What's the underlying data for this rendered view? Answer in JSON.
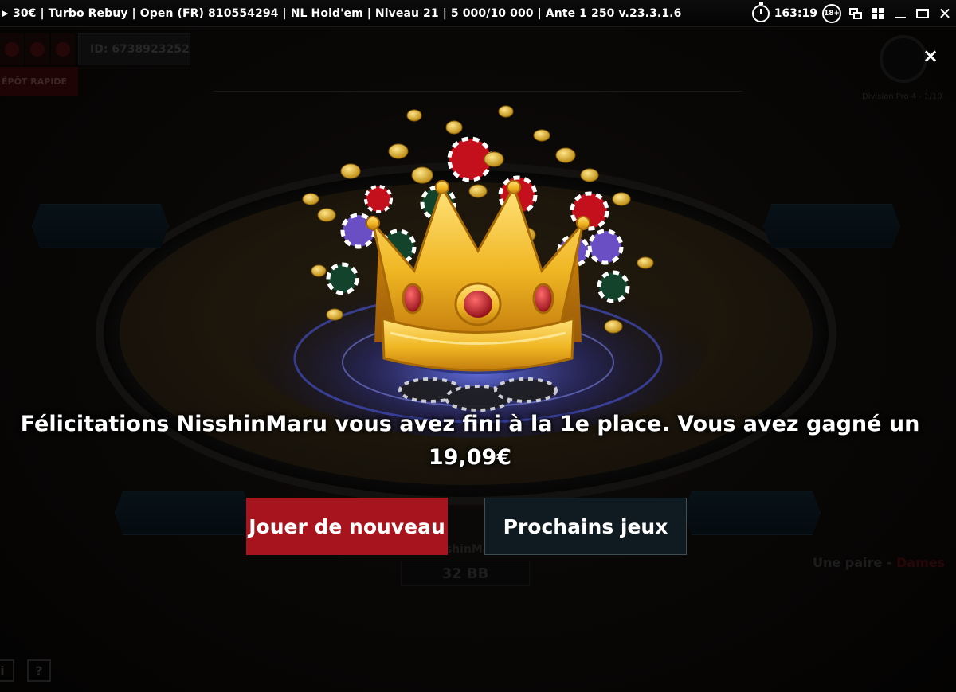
{
  "titlebar": {
    "title": "30€ | Turbo Rebuy | Open (FR) 810554294 | NL Hold'em | Niveau 21 | 5 000/10 000 | Ante 1 250 v.23.3.1.6",
    "timer": "163:19",
    "age_badge": "18+",
    "icons": [
      "timer-icon",
      "multi-table-icon",
      "tile-icon",
      "minimize-icon",
      "maximize-icon",
      "close-icon"
    ]
  },
  "table": {
    "player_id": "ID: 6738923252",
    "deposit_label": "ÉPÔT RAPIDE",
    "division": "Division Pro 4 - 1/10",
    "hero_name": "NisshinMaru",
    "hero_stack": "32 BB",
    "hand_prefix": "Une paire - ",
    "hand_value": "Dames",
    "bottom_icons": [
      "info-icon",
      "help-icon"
    ],
    "help_glyph": "?",
    "info_glyph": "i"
  },
  "popup": {
    "message_line1": "Félicitations NisshinMaru vous avez fini à la 1e place. Vous avez gagné un",
    "message_line2": "19,09€",
    "replay_label": "Jouer de nouveau",
    "next_games_label": "Prochains jeux",
    "close_glyph": "×"
  },
  "colors": {
    "replay_button": "#a7141e",
    "next_button": "#0f1a21",
    "crown_gold": "#f0b623",
    "ruby": "#c4101c"
  }
}
